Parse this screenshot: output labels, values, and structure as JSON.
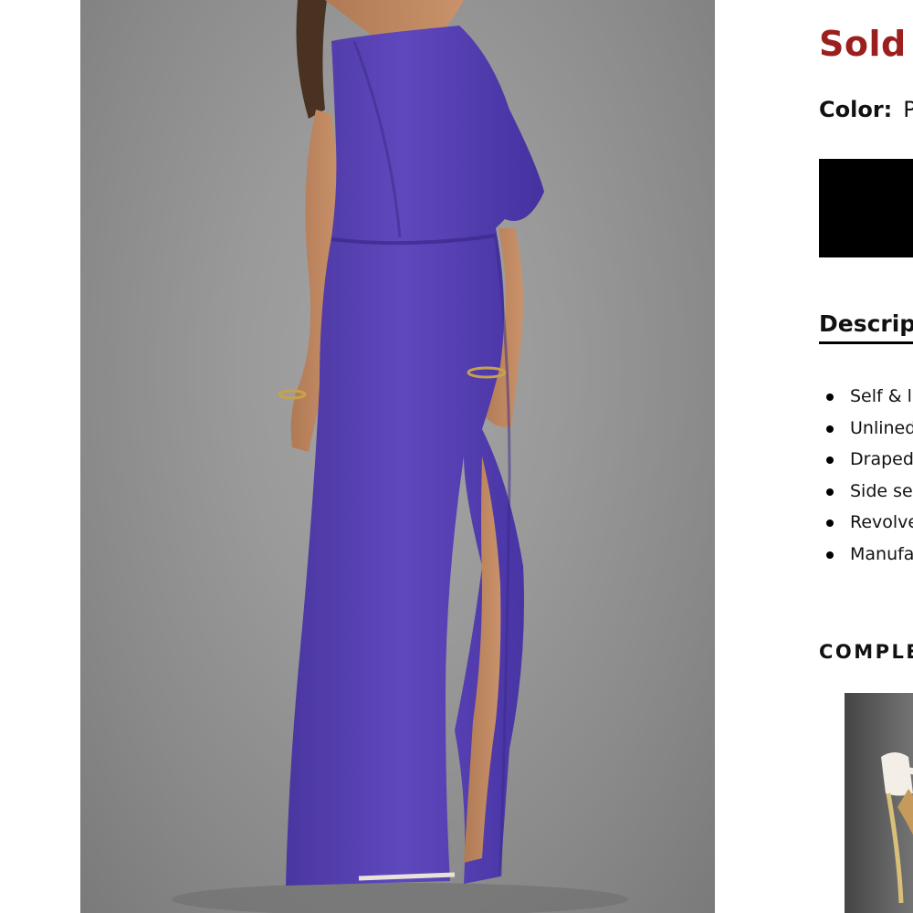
{
  "product": {
    "status_title": "Sold Out",
    "color_label": "Color:",
    "color_value": "Purple",
    "swatches": [
      {
        "color": "#000000"
      }
    ],
    "description": {
      "heading": "Description",
      "bullets": [
        "Self & lining",
        "Unlined",
        "Draped",
        "Side seam",
        "Revolve",
        "Manufactured"
      ]
    },
    "complete_the_look": {
      "heading": "COMPLETE THE LOOK"
    }
  },
  "colors": {
    "sold_out_red": "#9b1f1f",
    "dress_purple": "#5c45b8",
    "photo_background": "#9a9a9a"
  },
  "images": {
    "main_photo": "model wearing one-shoulder purple maxi dress",
    "complete_thumb": "strappy heeled sandal"
  }
}
